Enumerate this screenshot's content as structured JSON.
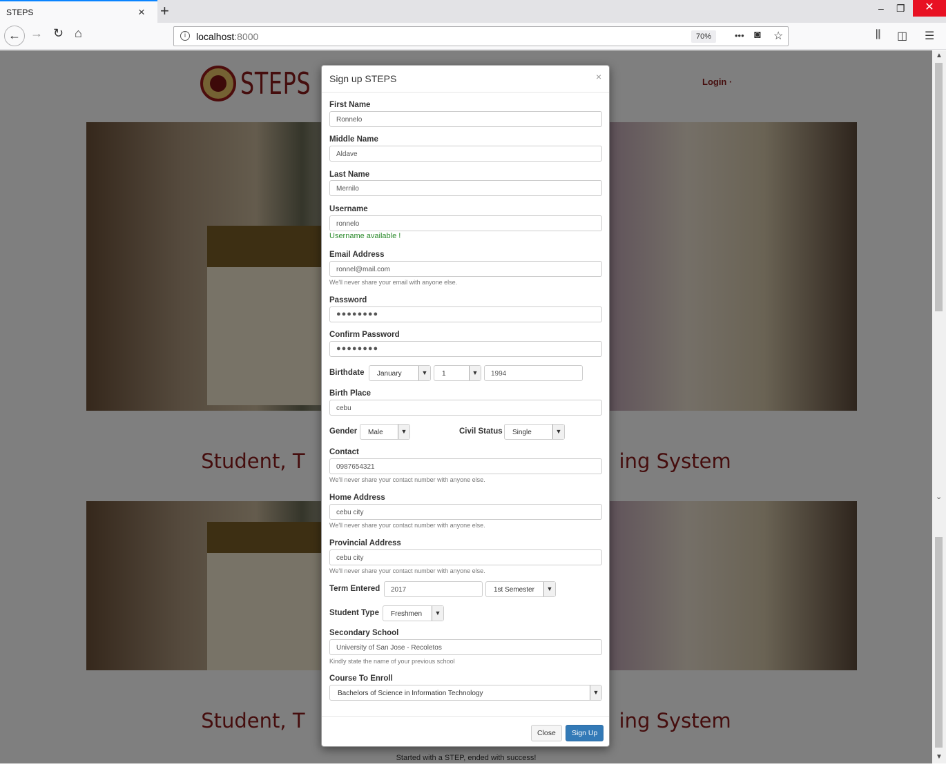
{
  "browser": {
    "tab_title": "STEPS",
    "tab_close": "×",
    "new_tab": "+",
    "url_host": "localhost",
    "url_port": ":8000",
    "zoom": "70%",
    "more": "•••"
  },
  "page": {
    "logo_text": "STEPS",
    "login": "Login ·",
    "headline_left": "Student, T",
    "headline_right": "ing System",
    "tagline": "Started with a STEP, ended with success!"
  },
  "modal": {
    "title": "Sign up STEPS",
    "close_x": "×",
    "first_name": {
      "label": "First Name",
      "value": "Ronnelo"
    },
    "middle_name": {
      "label": "Middle Name",
      "value": "Aldave"
    },
    "last_name": {
      "label": "Last Name",
      "value": "Mernilo"
    },
    "username": {
      "label": "Username",
      "value": "ronnelo",
      "status": "Username available !"
    },
    "email": {
      "label": "Email Address",
      "value": "ronnel@mail.com",
      "help": "We'll never share your email with anyone else."
    },
    "password": {
      "label": "Password",
      "value": "●●●●●●●●"
    },
    "confirm_password": {
      "label": "Confirm Password",
      "value": "●●●●●●●●"
    },
    "birthdate": {
      "label": "Birthdate",
      "month": "January",
      "day": "1",
      "year": "1994"
    },
    "birth_place": {
      "label": "Birth Place",
      "value": "cebu"
    },
    "gender": {
      "label": "Gender",
      "value": "Male"
    },
    "civil_status": {
      "label": "Civil Status",
      "value": "Single"
    },
    "contact": {
      "label": "Contact",
      "value": "0987654321",
      "help": "We'll never share your contact number with anyone else."
    },
    "home_address": {
      "label": "Home Address",
      "value": "cebu city",
      "help": "We'll never share your contact number with anyone else."
    },
    "provincial_address": {
      "label": "Provincial Address",
      "value": "cebu city",
      "help": "We'll never share your contact number with anyone else."
    },
    "term_entered": {
      "label": "Term Entered",
      "year": "2017",
      "semester": "1st Semester"
    },
    "student_type": {
      "label": "Student Type",
      "value": "Freshmen"
    },
    "secondary_school": {
      "label": "Secondary School",
      "value": "University of San Jose - Recoletos",
      "help": "Kindly state the name of your previous school"
    },
    "course": {
      "label": "Course To Enroll",
      "value": "Bachelors of Science in Information Technology"
    },
    "close_button": "Close",
    "signup_button": "Sign Up"
  },
  "colors": {
    "brand": "#8a1b1b",
    "primary": "#337ab7",
    "success": "#2b8a2b"
  }
}
